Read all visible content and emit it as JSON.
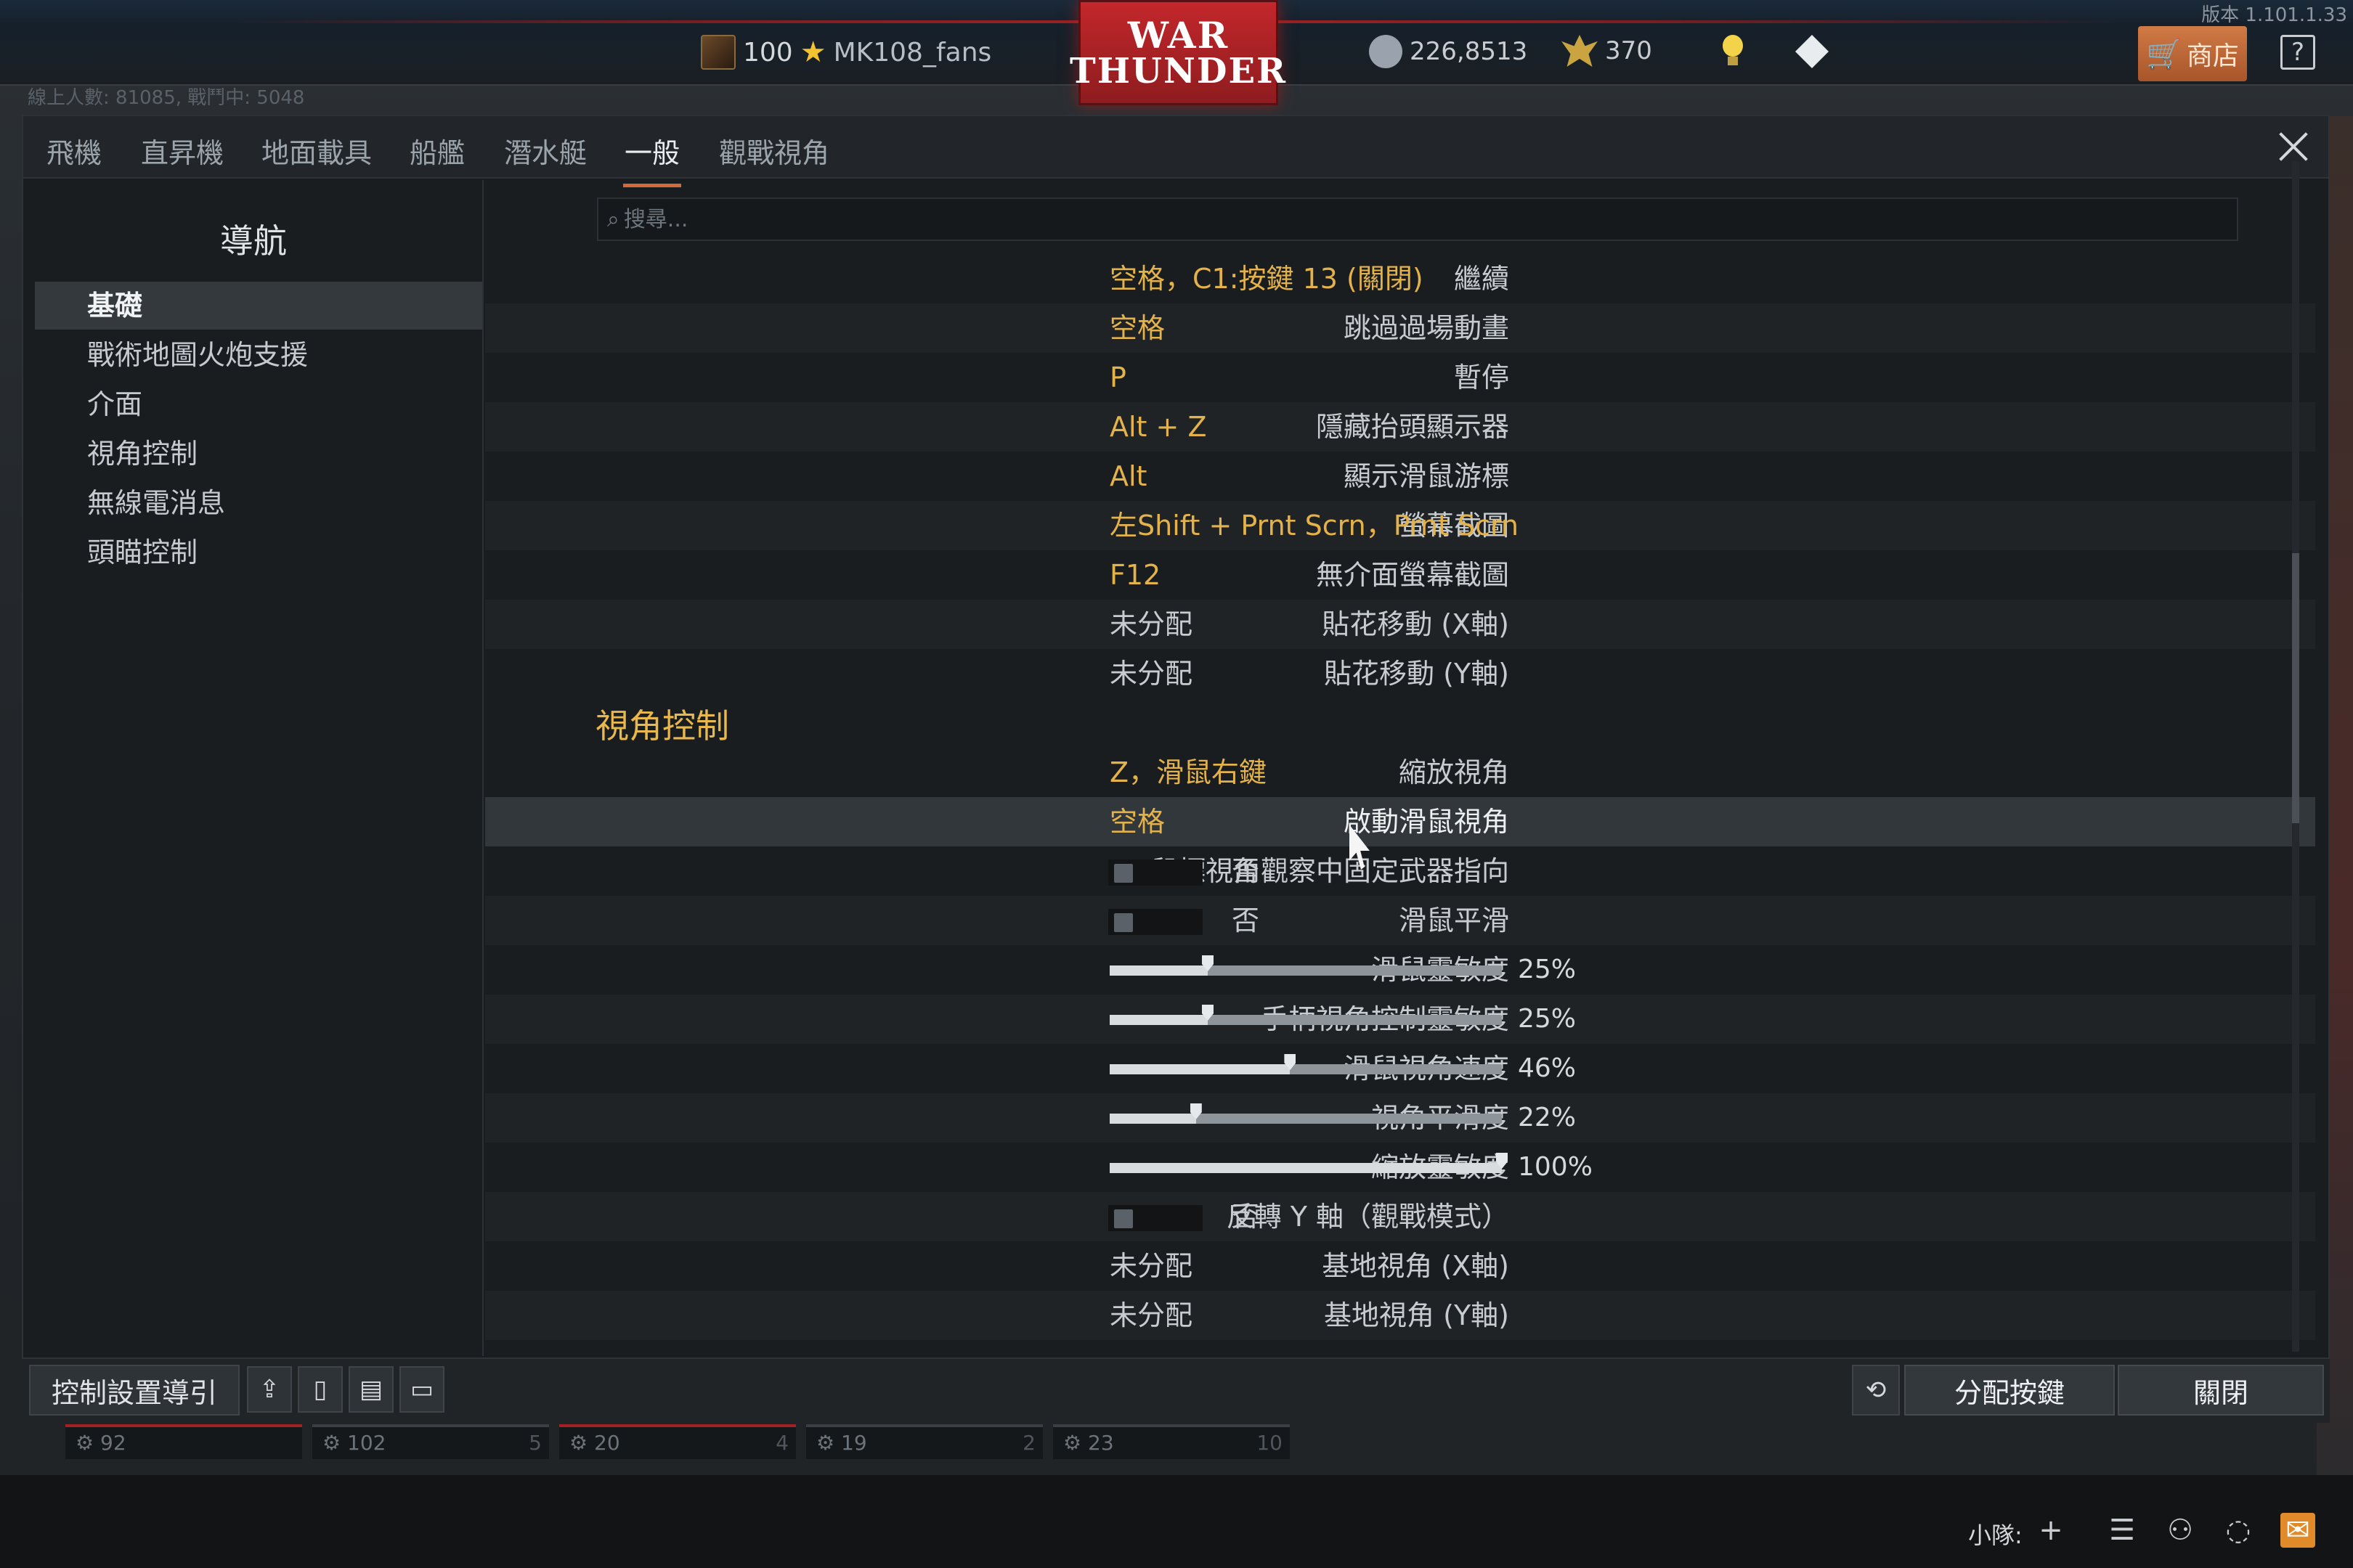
{
  "version": "版本 1.101.1.33",
  "topbar": {
    "rank_level": "100",
    "player_name": "MK108_fans",
    "logo_line1": "WAR",
    "logo_line2": "THUNDER",
    "silver_lions": "226,8513",
    "golden_eagles": "370",
    "shop_label": "商店",
    "help_label": "?"
  },
  "online_status": "線上人數: 81085, 戰鬥中: 5048",
  "tabs": [
    {
      "label": "飛機"
    },
    {
      "label": "直昇機"
    },
    {
      "label": "地面載具"
    },
    {
      "label": "船艦"
    },
    {
      "label": "潛水艇"
    },
    {
      "label": "一般",
      "active": true
    },
    {
      "label": "觀戰視角"
    }
  ],
  "nav": {
    "title": "導航",
    "items": [
      {
        "label": "基礎",
        "active": true
      },
      {
        "label": "戰術地圖火炮支援"
      },
      {
        "label": "介面"
      },
      {
        "label": "視角控制"
      },
      {
        "label": "無線電消息"
      },
      {
        "label": "頭瞄控制"
      }
    ]
  },
  "search": {
    "placeholder": "搜尋..."
  },
  "settings": [
    {
      "label": "繼續",
      "value": "空格，C1:按鍵 13 (關閉)"
    },
    {
      "label": "跳過過場動畫",
      "value": "空格"
    },
    {
      "label": "暫停",
      "value": "P"
    },
    {
      "label": "隱藏抬頭顯示器",
      "value": "Alt + Z"
    },
    {
      "label": "顯示滑鼠游標",
      "value": "Alt"
    },
    {
      "label": "螢幕截圖",
      "value": "左Shift + Prnt Scrn，Prnt Scrn"
    },
    {
      "label": "無介面螢幕截圖",
      "value": "F12"
    },
    {
      "label": "貼花移動 (X軸)",
      "value": "未分配"
    },
    {
      "label": "貼花移動 (Y軸)",
      "value": "未分配"
    }
  ],
  "section_view": {
    "title": "視角控制",
    "rows": [
      {
        "label": "縮放視角",
        "value": "Z，滑鼠右鍵"
      },
      {
        "label": "啟動滑鼠視角",
        "value": "空格"
      },
      {
        "label": "鼠標視角觀察中固定武器指向",
        "toggle": "否"
      },
      {
        "label": "滑鼠平滑",
        "toggle": "否"
      },
      {
        "label": "滑鼠靈敏度",
        "slider": 25,
        "display": "25%"
      },
      {
        "label": "手柄視角控制靈敏度",
        "slider": 25,
        "display": "25%"
      },
      {
        "label": "滑鼠視角速度",
        "slider": 46,
        "display": "46%"
      },
      {
        "label": "視角平滑度",
        "slider": 22,
        "display": "22%"
      },
      {
        "label": "縮放靈敏度",
        "slider": 100,
        "display": "100%"
      },
      {
        "label": "反轉 Y 軸（觀戰模式）",
        "toggle": "否"
      },
      {
        "label": "基地視角 (X軸)",
        "value": "未分配"
      },
      {
        "label": "基地視角 (Y軸)",
        "value": "未分配"
      }
    ]
  },
  "bottombar": {
    "guide_label": "控制設置導引",
    "assign_label": "分配按鍵",
    "close_label": "關閉"
  },
  "crew_slots": [
    {
      "left": "92",
      "right": ""
    },
    {
      "left": "102",
      "right": "5"
    },
    {
      "left": "20",
      "right": "4"
    },
    {
      "left": "19",
      "right": "2"
    },
    {
      "left": "23",
      "right": "10"
    }
  ],
  "statusbar": {
    "squad_label": "小隊:"
  },
  "colors": {
    "accent": "#e4b24a",
    "tab_underline": "#d2693a",
    "logo_red": "#c2272b"
  }
}
